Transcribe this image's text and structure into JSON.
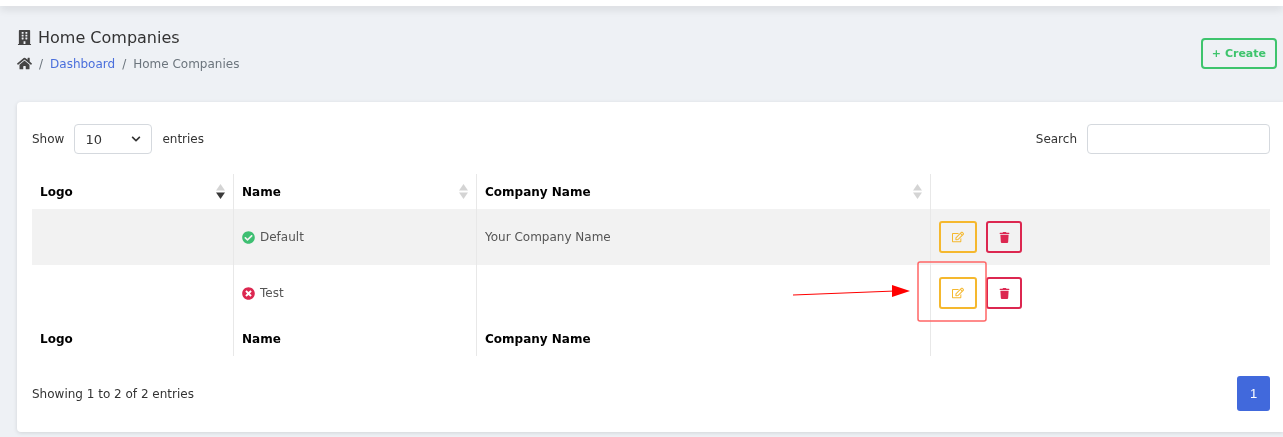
{
  "header": {
    "title": "Home Companies",
    "breadcrumb": [
      {
        "separator": "/",
        "label": "Dashboard",
        "kind": "link"
      },
      {
        "separator": "/",
        "label": "Home Companies",
        "kind": "current"
      }
    ],
    "create_button": "+ Create"
  },
  "controls": {
    "show_label": "Show",
    "page_length": "10",
    "entries_label": "entries",
    "search_label": "Search"
  },
  "table": {
    "columns": [
      {
        "label": "Logo",
        "sortable": true,
        "sorted": true
      },
      {
        "label": "Name",
        "sortable": true,
        "sorted": false
      },
      {
        "label": "Company Name",
        "sortable": true,
        "sorted": false
      }
    ],
    "rows": [
      {
        "name": "Default",
        "active": true,
        "company_name": "Your Company Name"
      },
      {
        "name": "Test",
        "active": false
      }
    ],
    "footer_columns": [
      "Logo",
      "Name",
      "Company Name"
    ]
  },
  "info": "Showing 1 to 2 of 2 entries",
  "pagination": [
    {
      "label": "1",
      "selected": true
    }
  ]
}
